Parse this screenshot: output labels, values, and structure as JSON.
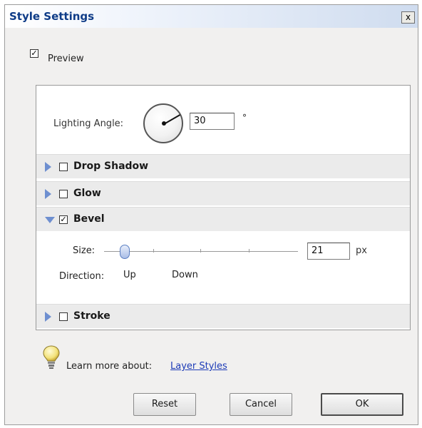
{
  "window": {
    "title": "Style Settings",
    "close_glyph": "x"
  },
  "preview": {
    "label": "Preview",
    "checked": true
  },
  "lighting": {
    "label": "Lighting Angle:",
    "value": "30",
    "unit": "°",
    "angle_degrees": 30
  },
  "sections": {
    "drop_shadow": {
      "label": "Drop Shadow",
      "checked": false,
      "expanded": false
    },
    "glow": {
      "label": "Glow",
      "checked": false,
      "expanded": false
    },
    "bevel": {
      "label": "Bevel",
      "checked": true,
      "expanded": true
    },
    "stroke": {
      "label": "Stroke",
      "checked": false,
      "expanded": false
    }
  },
  "bevel_settings": {
    "size_label": "Size:",
    "size_value": "21",
    "size_unit": "px",
    "direction_label": "Direction:",
    "direction_options": [
      "Up",
      "Down"
    ]
  },
  "learn": {
    "label": "Learn more about:",
    "link": "Layer Styles"
  },
  "buttons": {
    "reset": "Reset",
    "cancel": "Cancel",
    "ok": "OK"
  },
  "colors": {
    "title_text": "#0f3c87",
    "link": "#1d3bb7",
    "expander": "#6e8fd0",
    "slider_thumb": "#a9bde6"
  },
  "icons": {
    "close": "close-icon",
    "expander": "triangle-icon",
    "tip": "lightbulb-icon",
    "angle": "dial-icon"
  }
}
